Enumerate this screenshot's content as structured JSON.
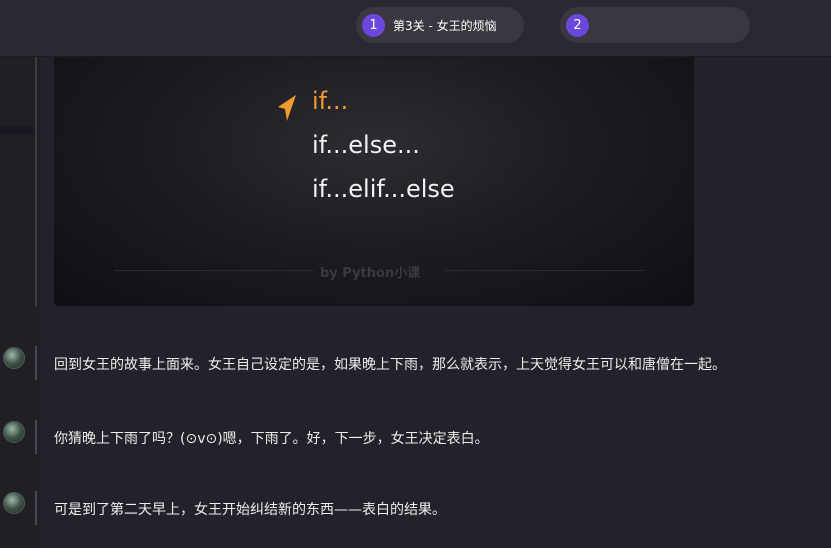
{
  "steps": [
    {
      "number": "1",
      "label": "第3关 - 女王的烦恼"
    },
    {
      "number": "2",
      "label": ""
    }
  ],
  "slide": {
    "lines": [
      "if...",
      "if...else...",
      "if...elif...else"
    ],
    "active_line": 0,
    "active_color": "#f29a2e",
    "watermark": "by Python小课"
  },
  "messages": [
    {
      "text": "回到女王的故事上面来。女王自己设定的是，如果晚上下雨，那么就表示，上天觉得女王可以和唐僧在一起。"
    },
    {
      "text": "你猜晚上下雨了吗？(⊙v⊙)嗯，下雨了。好，下一步，女王决定表白。"
    },
    {
      "text": "可是到了第二天早上，女王开始纠结新的东西——表白的结果。"
    }
  ],
  "colors": {
    "accent": "#6b47dc",
    "background": "#24212b"
  }
}
